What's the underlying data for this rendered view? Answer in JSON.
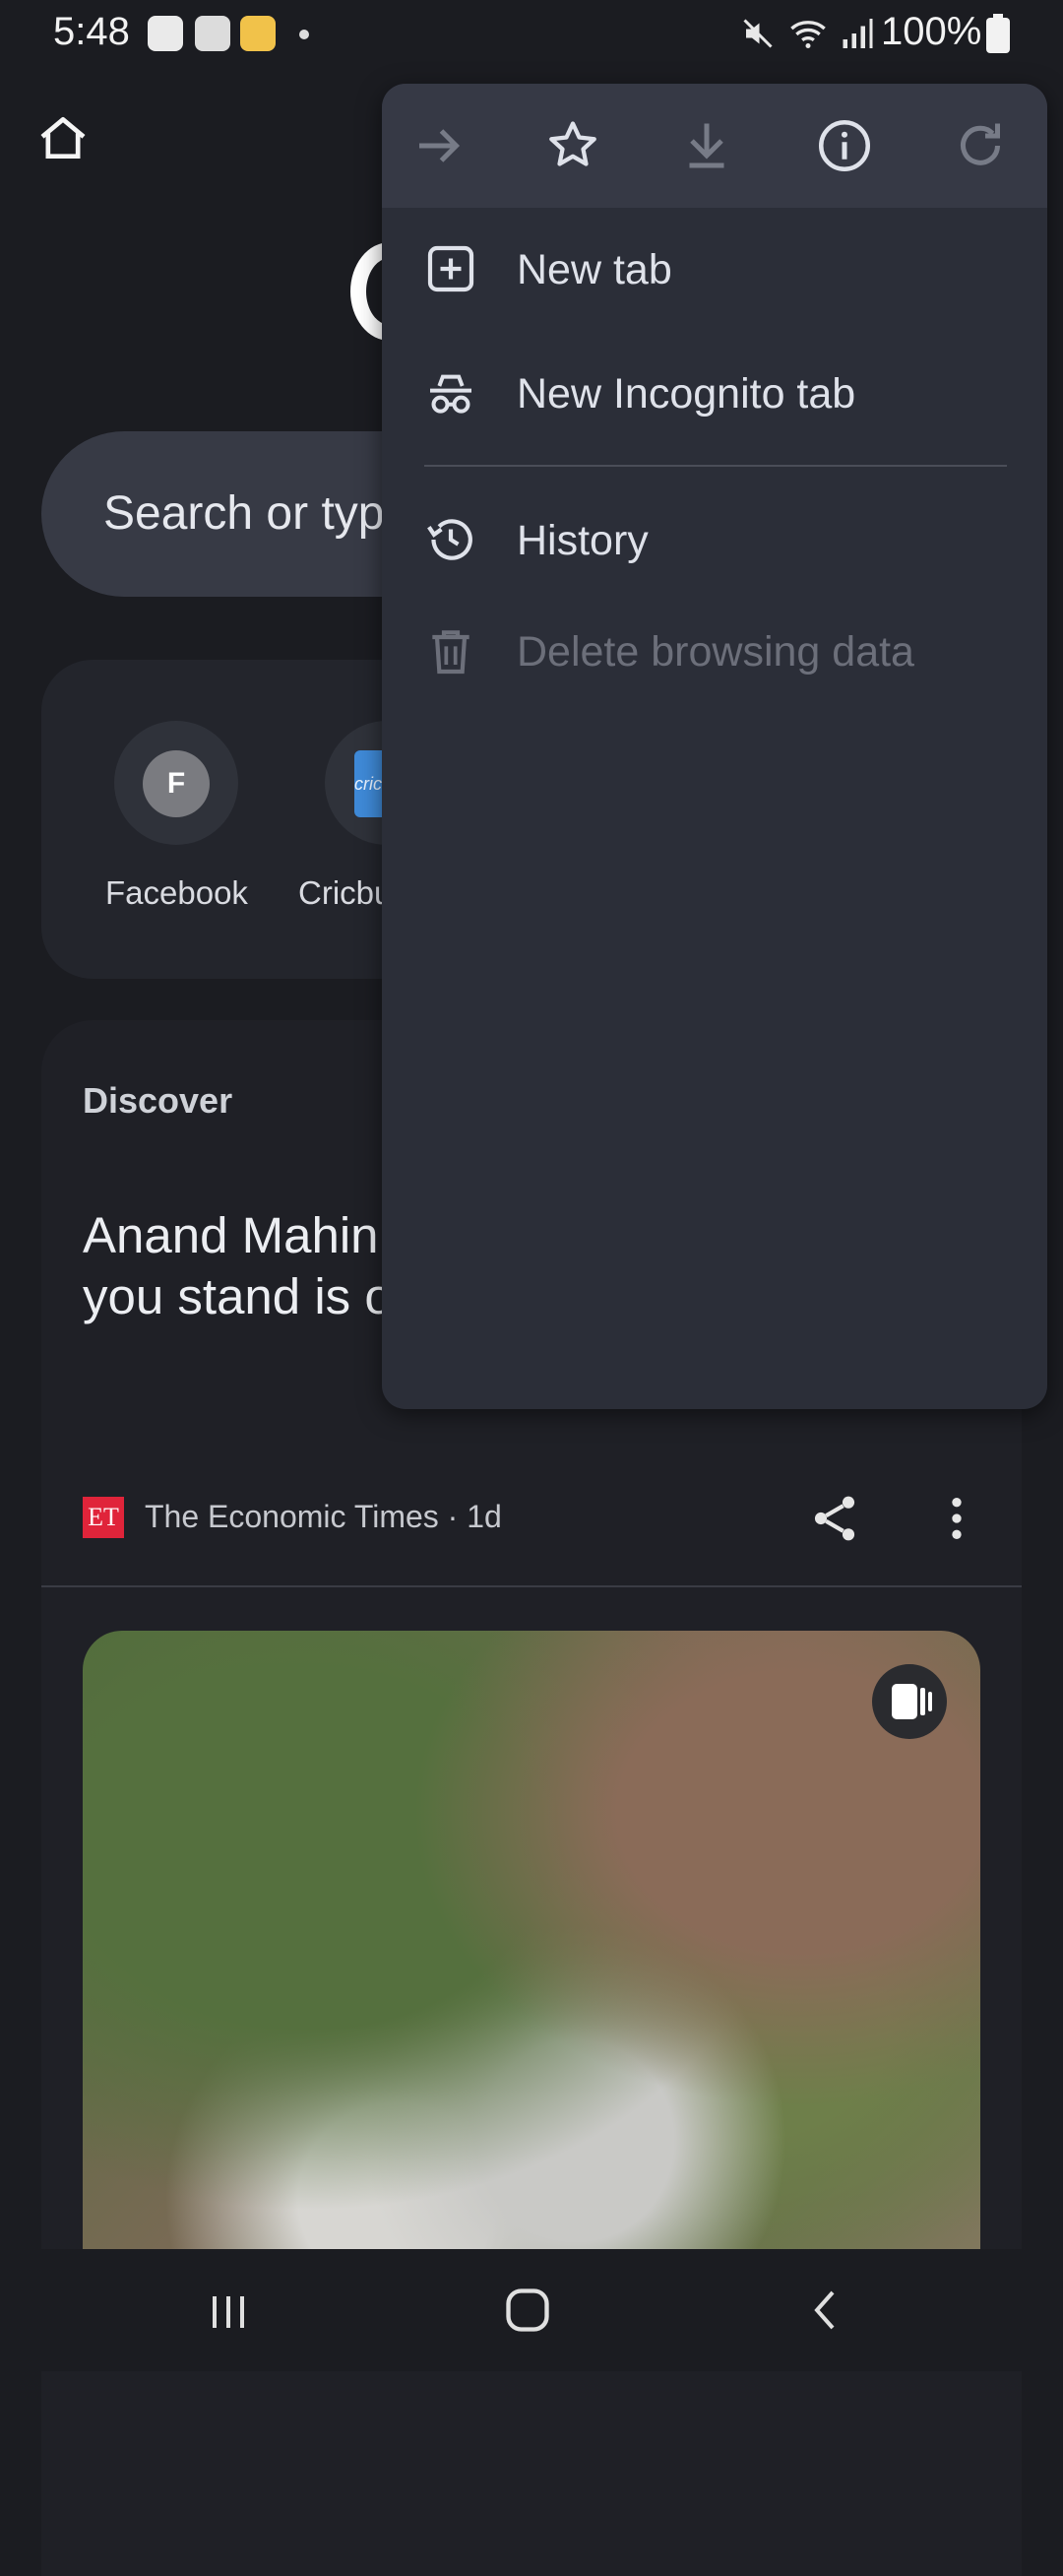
{
  "status_bar": {
    "time": "5:48",
    "battery": "100%",
    "icons": [
      "s-app-icon",
      "gallery-icon",
      "app-notification-icon",
      "dot-icon",
      "mute-icon",
      "wifi-icon",
      "signal-icon",
      "battery-icon"
    ]
  },
  "page": {
    "search_placeholder": "Search or type",
    "shortcuts": [
      {
        "label": "Facebook",
        "letter": "F"
      },
      {
        "label": "Cricbu",
        "letter": "cric"
      }
    ],
    "discover_label": "Discover",
    "article": {
      "headline": "Anand Mahin moment gets twist: 'Sir, you stand is out'",
      "source": "The Economic Times · 1d",
      "source_logo": "ET"
    }
  },
  "menu": {
    "toolbar": [
      "forward-icon",
      "bookmark-star-icon",
      "download-icon",
      "info-icon",
      "reload-icon"
    ],
    "items": [
      {
        "label": "New tab",
        "icon": "new-tab-icon",
        "enabled": true
      },
      {
        "label": "New Incognito tab",
        "icon": "incognito-icon",
        "enabled": true
      },
      {
        "label": "History",
        "icon": "history-icon",
        "enabled": true
      },
      {
        "label": "Delete browsing data",
        "icon": "trash-icon",
        "enabled": false
      }
    ]
  },
  "colors": {
    "background": "#1b1c21",
    "menu_bg": "#2b2e38",
    "menu_top": "#363945",
    "search_bg": "#373a45",
    "et_red": "#e0243a"
  }
}
